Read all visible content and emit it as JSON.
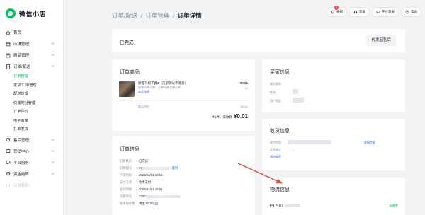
{
  "brand": {
    "title": "微信小店"
  },
  "sidebar": {
    "items": [
      {
        "label": "首页",
        "icon": "home-icon",
        "has_chevron": false
      },
      {
        "label": "店铺管理",
        "icon": "shop-icon",
        "has_chevron": true
      },
      {
        "label": "商品管理",
        "icon": "goods-icon",
        "has_chevron": true
      },
      {
        "label": "订单/配送",
        "icon": "order-icon",
        "has_chevron": true,
        "expanded": true
      }
    ],
    "subitems": [
      {
        "label": "订单管理",
        "active": true
      },
      {
        "label": "发货工具/管理",
        "active": false
      },
      {
        "label": "配送管理",
        "active": false
      },
      {
        "label": "快递地址管理",
        "active": false
      },
      {
        "label": "订单评价",
        "active": false
      },
      {
        "label": "电子面单",
        "active": false
      },
      {
        "label": "打单发货",
        "active": false
      }
    ],
    "items_after": [
      {
        "label": "售后管理",
        "icon": "aftersale-icon",
        "has_chevron": true
      },
      {
        "label": "营销中心",
        "icon": "marketing-icon",
        "has_chevron": true
      },
      {
        "label": "平台服务",
        "icon": "service-icon",
        "has_chevron": true
      },
      {
        "label": "资金结算",
        "icon": "money-icon",
        "has_chevron": true
      },
      {
        "label": "店铺数据",
        "icon": "data-icon",
        "has_chevron": false,
        "dim": true
      }
    ]
  },
  "breadcrumb": {
    "level1": "订单/配送",
    "level2": "订单管理",
    "current": "订单详情",
    "separator": "/"
  },
  "header_tools": {
    "notify": {
      "label": "通知",
      "badge": "8"
    },
    "mail": {
      "label": "客服"
    },
    "platform": {
      "label": "平台客服"
    },
    "more": {
      "label": "帮助"
    }
  },
  "status_card": {
    "status": "已完成",
    "action_label": "代发起售后"
  },
  "goods": {
    "title": "订单商品",
    "name": "顾客乌梅子酱2（内部测试不发货）",
    "spec": "顾客乌梅子酱；订单乌梅子酱示例",
    "snapshot_label": "商品快照",
    "price": "¥0.01",
    "qty": "x1",
    "subtotal_label": "商品总价",
    "subtotal_value": "¥0.01",
    "total_prefix": "共1件，实收款",
    "total_value": "¥0.01"
  },
  "order_info": {
    "title": "订单信息",
    "rows": [
      {
        "label": "订单状态",
        "value": "已完成"
      },
      {
        "label": "订单编号",
        "value": "37",
        "copy": "复制"
      },
      {
        "label": "下单时间",
        "value": "2025/04/01 10:13"
      },
      {
        "label": "支付方式",
        "value": "免用支付"
      },
      {
        "label": "支付时间",
        "value": "2025/04/01 15:51"
      },
      {
        "label": "交易单号",
        "value": "4200"
      },
      {
        "label": "技术服务费",
        "value": "预估 ¥0.00"
      }
    ]
  },
  "buyer": {
    "title": "买家信息",
    "rows": [
      "微信昵称",
      "性别",
      "用户地区"
    ]
  },
  "receiver": {
    "title": "收货信息",
    "rows": [
      "收货信息",
      "买家留言",
      "订单标签"
    ],
    "detail_link": "详细信息",
    "message_value": "-",
    "tag_link": "添加标签"
  },
  "logistics": {
    "title": "物流信息",
    "carrier": "包裹1",
    "state": "运输中"
  },
  "colors": {
    "brand": "#07c160",
    "link": "#165dff",
    "arrow": "#e34a3a"
  }
}
